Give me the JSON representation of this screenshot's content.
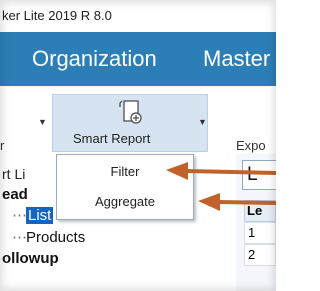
{
  "titlebar": {
    "title": "ker Lite 2019 R 8.0"
  },
  "menubar": {
    "items": [
      "Organization",
      "Master"
    ]
  },
  "toolbar": {
    "left_label": "r",
    "smart_report_label": "Smart Report",
    "export_label": "Expo"
  },
  "dropdown": {
    "items": [
      "Filter",
      "Aggregate"
    ]
  },
  "tree": {
    "title": "rt Li",
    "lead": "ead",
    "list": "List",
    "products": "Products",
    "followup": "ollowup"
  },
  "grid": {
    "tab": "L",
    "header": "Le",
    "rows": [
      "1",
      "2"
    ]
  },
  "colors": {
    "menubar": "#2c7fb6",
    "selection": "#1565c0",
    "arrow": "#c0622a"
  }
}
